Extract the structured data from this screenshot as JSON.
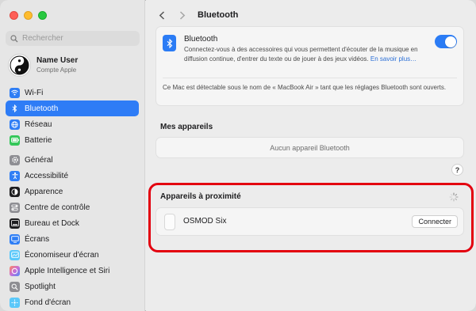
{
  "sidebar": {
    "search_placeholder": "Rechercher",
    "account": {
      "name": "Name User",
      "subtitle": "Compte Apple"
    },
    "items": [
      {
        "label": "Wi-Fi",
        "icon": "wifi-icon",
        "color": "#2f7ef5"
      },
      {
        "label": "Bluetooth",
        "icon": "bluetooth-icon",
        "color": "#2f7ef5",
        "active": true
      },
      {
        "label": "Réseau",
        "icon": "globe-icon",
        "color": "#2f7ef5"
      },
      {
        "label": "Batterie",
        "icon": "battery-icon",
        "color": "#34c759"
      },
      {
        "label": "Général",
        "icon": "gear-icon",
        "color": "#8e8e93"
      },
      {
        "label": "Accessibilité",
        "icon": "accessibility-icon",
        "color": "#2f7ef5"
      },
      {
        "label": "Apparence",
        "icon": "appearance-icon",
        "color": "#1d1d1f"
      },
      {
        "label": "Centre de contrôle",
        "icon": "control-center-icon",
        "color": "#8e8e93"
      },
      {
        "label": "Bureau et Dock",
        "icon": "dock-icon",
        "color": "#1d1d1f"
      },
      {
        "label": "Écrans",
        "icon": "display-icon",
        "color": "#2f7ef5"
      },
      {
        "label": "Économiseur d'écran",
        "icon": "screensaver-icon",
        "color": "#5ac8fa"
      },
      {
        "label": "Apple Intelligence et Siri",
        "icon": "siri-icon",
        "color": "#c86dd7"
      },
      {
        "label": "Spotlight",
        "icon": "spotlight-icon",
        "color": "#8e8e93"
      },
      {
        "label": "Fond d'écran",
        "icon": "wallpaper-icon",
        "color": "#5ac8fa"
      }
    ]
  },
  "toolbar": {
    "title": "Bluetooth"
  },
  "bluetooth": {
    "title": "Bluetooth",
    "description": "Connectez-vous à des accessoires qui vous permettent d'écouter de la musique en diffusion continue, d'entrer du texte ou de jouer à des jeux vidéos.",
    "learn_more": "En savoir plus…",
    "enabled": true,
    "visibility_note": "Ce Mac est détectable sous le nom de « MacBook Air » tant que les réglages Bluetooth sont ouverts."
  },
  "my_devices": {
    "title": "Mes appareils",
    "empty": "Aucun appareil Bluetooth"
  },
  "help_label": "?",
  "nearby": {
    "title": "Appareils à proximité",
    "devices": [
      {
        "name": "OSMOD Six",
        "action": "Connecter"
      }
    ]
  },
  "colors": {
    "accent": "#2b7cf5",
    "highlight": "#e3000f"
  }
}
